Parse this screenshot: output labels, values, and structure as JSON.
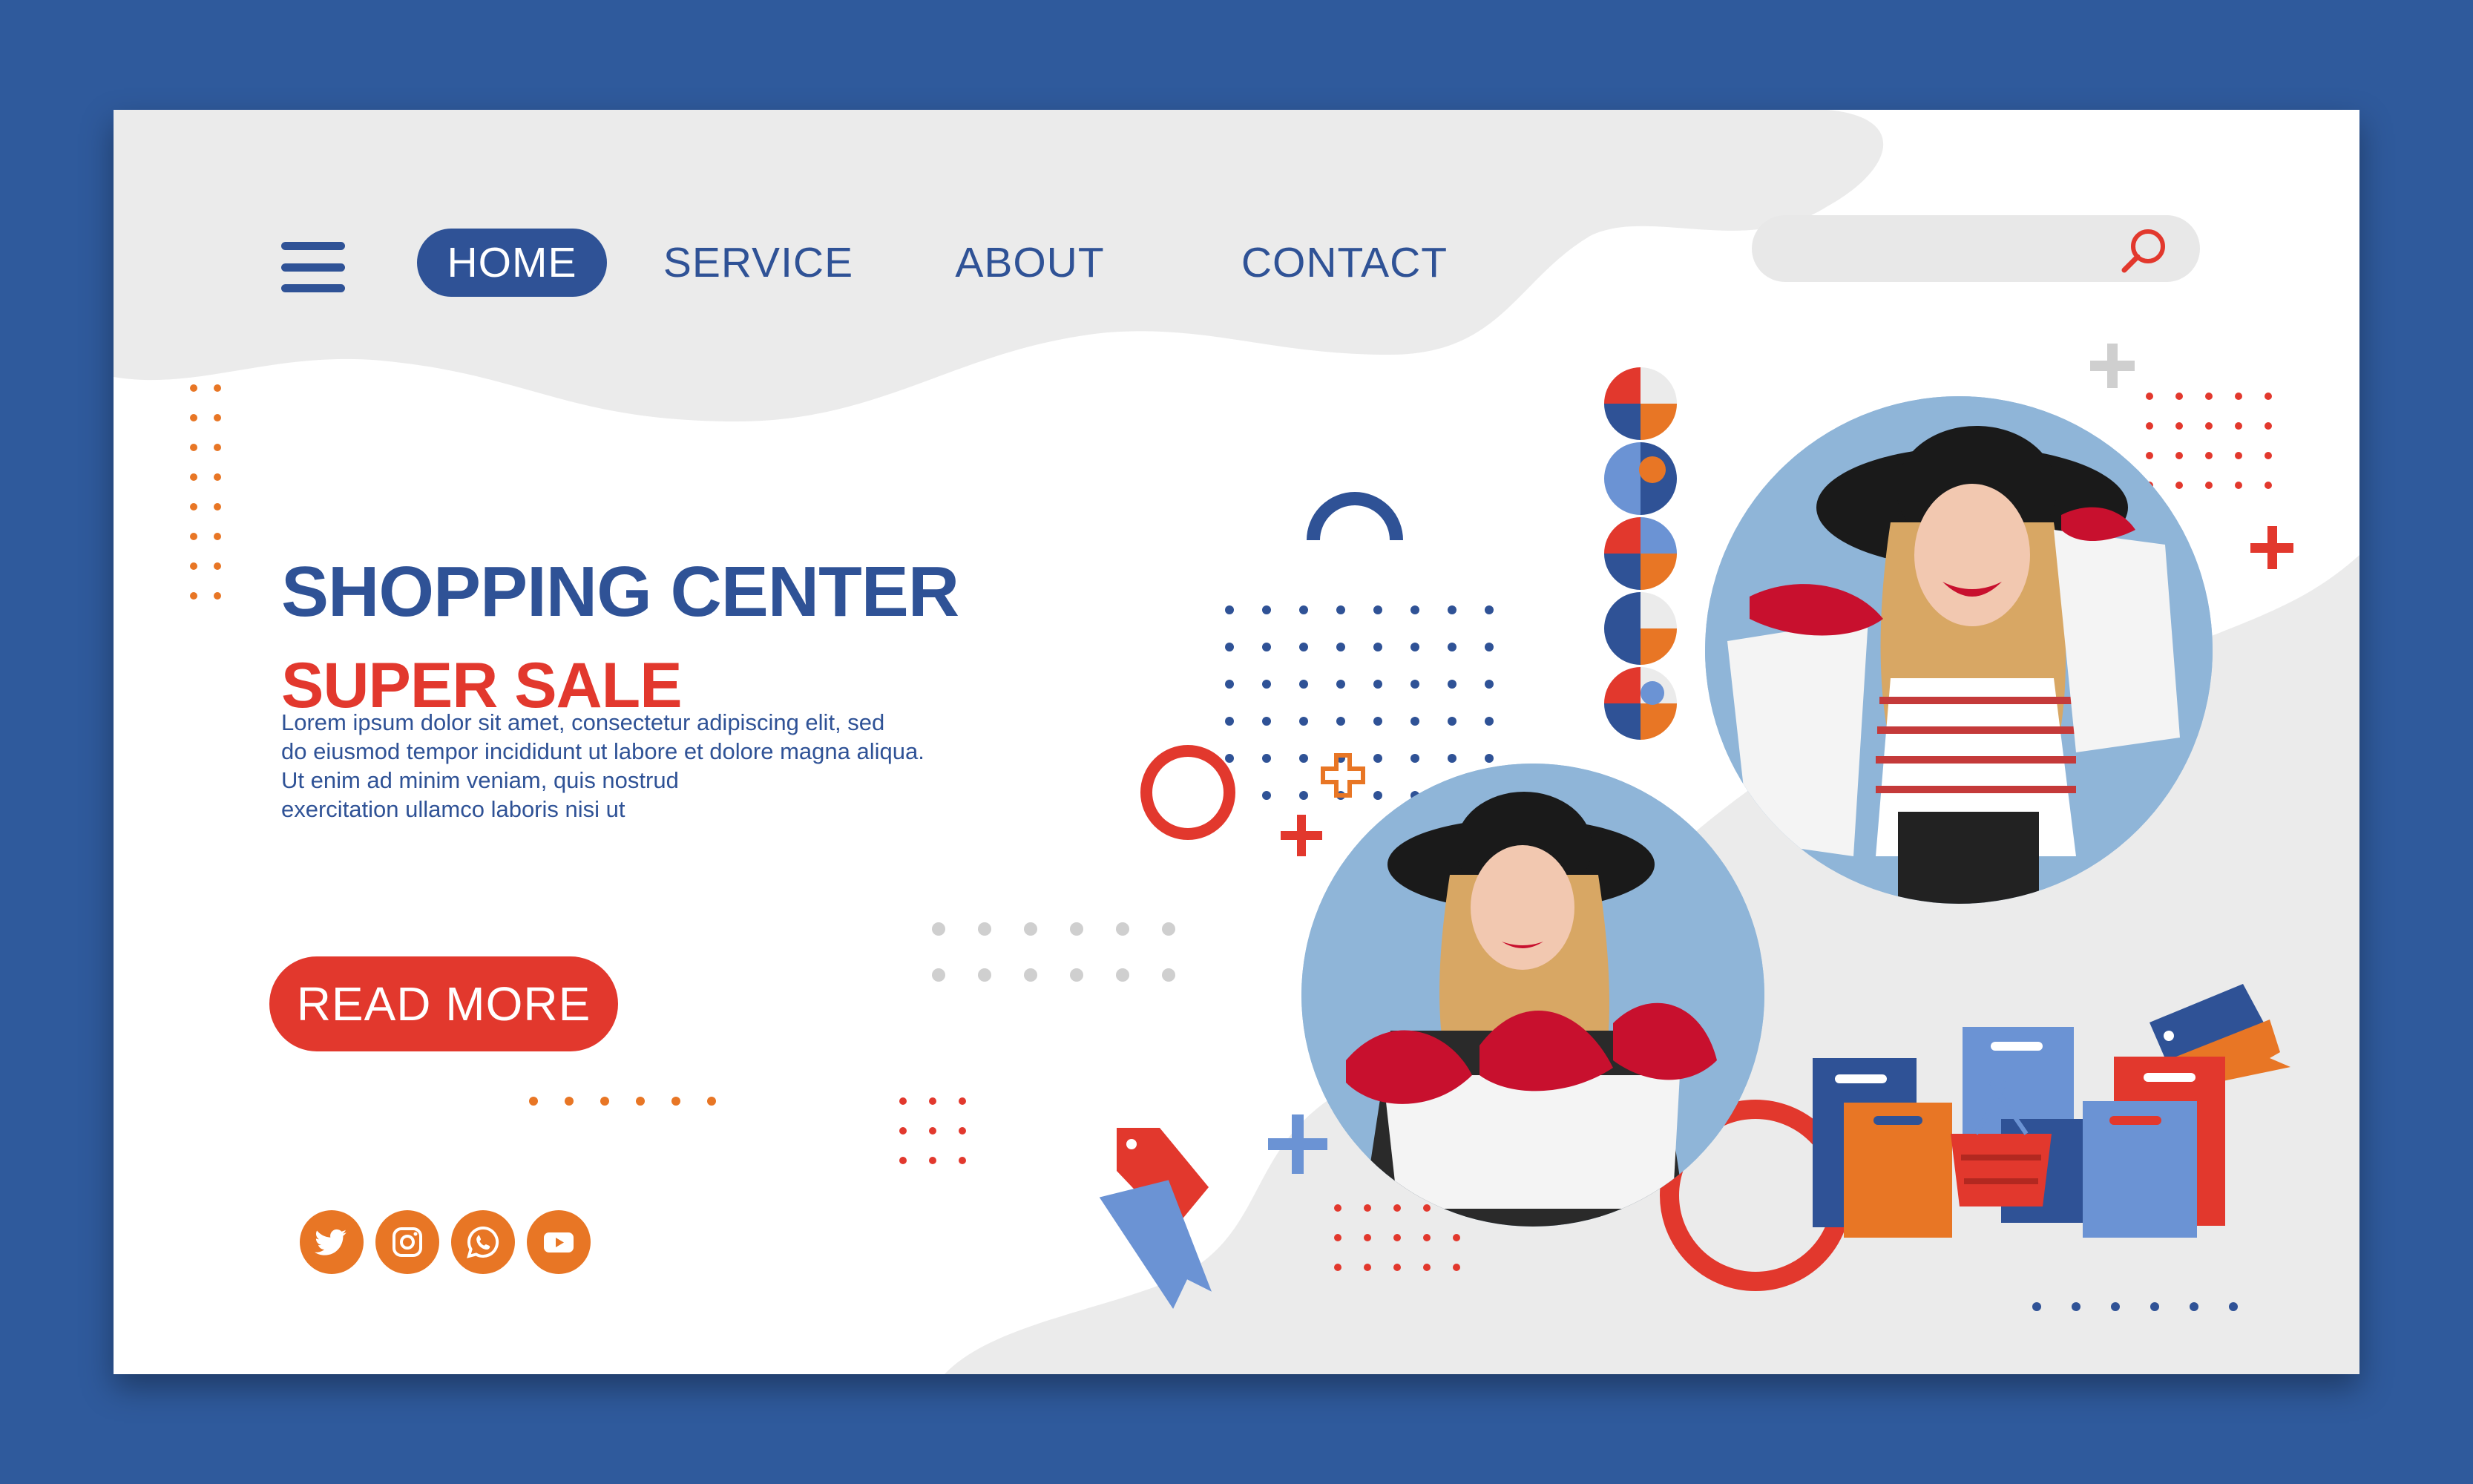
{
  "nav": {
    "items": [
      {
        "label": "HOME",
        "active": true
      },
      {
        "label": "SERVICE",
        "active": false
      },
      {
        "label": "ABOUT",
        "active": false
      },
      {
        "label": "CONTACT",
        "active": false
      }
    ]
  },
  "search": {
    "placeholder": "",
    "value": "",
    "icon": "search-icon"
  },
  "hero": {
    "title": "SHOPPING CENTER",
    "subtitle": "SUPER SALE",
    "body_lines": [
      "Lorem ipsum dolor sit amet, consectetur adipiscing elit, sed",
      "do eiusmod tempor incididunt ut labore et dolore magna aliqua.",
      "Ut enim ad minim veniam, quis nostrud",
      "exercitation ullamco laboris nisi ut"
    ],
    "cta_label": "READ MORE"
  },
  "social": [
    "twitter-icon",
    "instagram-icon",
    "whatsapp-icon",
    "youtube-icon"
  ],
  "colors": {
    "frame": "#2f5a9c",
    "navy": "#2f5296",
    "red": "#e2382d",
    "orange": "#e87625",
    "light_blue": "#6b93d4",
    "pale_gray": "#ebebeb"
  }
}
